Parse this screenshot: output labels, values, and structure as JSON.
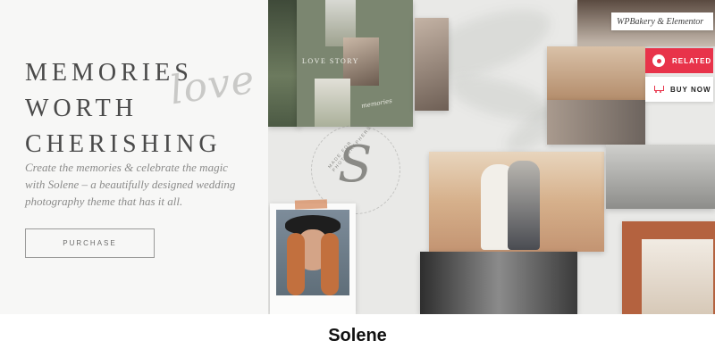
{
  "hero": {
    "headline_lines": [
      "MEMORIES",
      "WORTH",
      "CHERISHING"
    ],
    "script_word": "love",
    "description": "Create the memories & celebrate the magic with Solene – a beautifully designed wedding photography theme that has it all.",
    "purchase_label": "PURCHASE"
  },
  "collage": {
    "love_story_label": "LOVE STORY",
    "stamp_ring_text": "MADE FOR PHOTOGRAPHERS",
    "wpbakery_label": "WPBakery & Elementor",
    "related_label": "RELATED",
    "buy_now_label": "BUY NOW"
  },
  "caption": {
    "title": "Solene"
  },
  "colors": {
    "accent_red": "#e8334a",
    "sage_green": "#7b8670",
    "text_gray": "#4a4a4a"
  }
}
